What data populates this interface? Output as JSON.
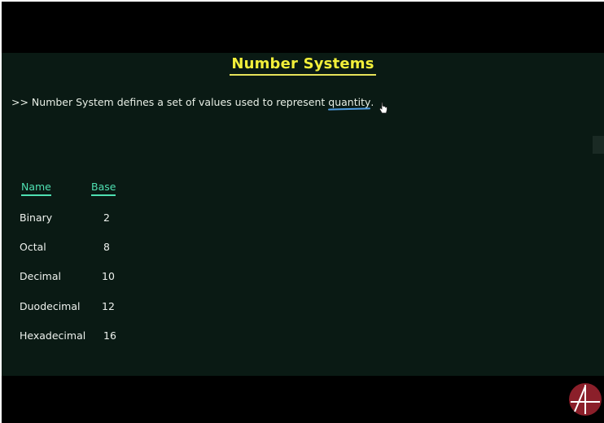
{
  "lecture": {
    "title": "Number Systems",
    "definition_prefix": ">> Number System defines a set of values used to represent ",
    "definition_keyword": "quantity",
    "definition_suffix": "."
  },
  "table": {
    "headers": {
      "name": "Name",
      "base": "Base"
    },
    "rows": [
      {
        "name": "Binary",
        "base": "2"
      },
      {
        "name": "Octal",
        "base": "8"
      },
      {
        "name": "Decimal",
        "base": "10"
      },
      {
        "name": "Duodecimal",
        "base": "12"
      },
      {
        "name": "Hexadecimal",
        "base": "16"
      }
    ]
  },
  "colors": {
    "board": "#0a1a14",
    "title": "#f2ef3a",
    "header": "#4fe0b2",
    "keyword_underline": "#4e9be0",
    "logo": "#8b1f2a"
  },
  "icons": {
    "cursor": "hand-pointer-icon",
    "logo": "channel-logo-icon"
  }
}
